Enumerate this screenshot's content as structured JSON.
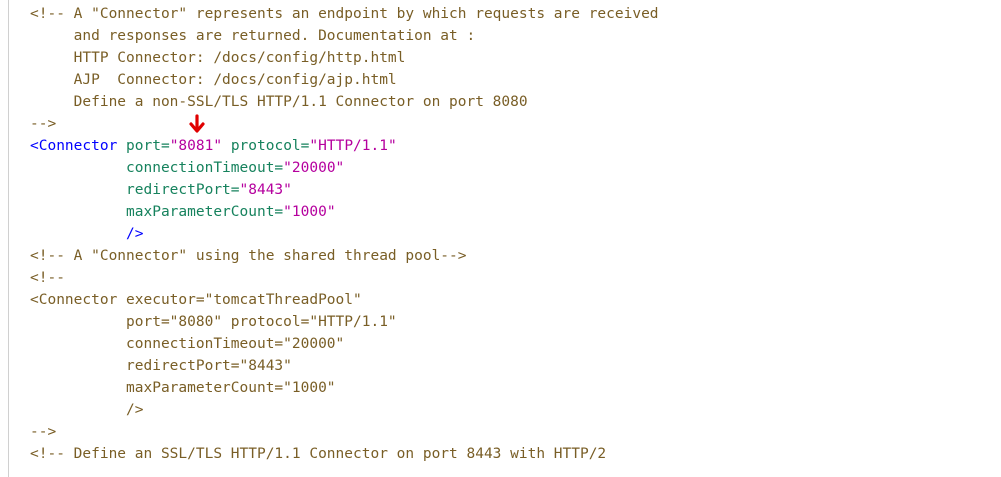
{
  "lines": [
    {
      "indent": 30,
      "segments": [
        {
          "t": "<!-- A \"Connector\" represents an endpoint by which requests are received",
          "c": "c-olive"
        }
      ]
    },
    {
      "indent": 30,
      "segments": [
        {
          "t": "     and responses are returned. Documentation at :",
          "c": "c-olive"
        }
      ]
    },
    {
      "indent": 30,
      "segments": [
        {
          "t": "     HTTP Connector: /docs/config/http.html",
          "c": "c-olive"
        }
      ]
    },
    {
      "indent": 30,
      "segments": [
        {
          "t": "     AJP  Connector: /docs/config/ajp.html",
          "c": "c-olive"
        }
      ]
    },
    {
      "indent": 30,
      "segments": [
        {
          "t": "     Define a non-SSL/TLS HTTP/1.1 Connector on port 8080",
          "c": "c-olive"
        }
      ]
    },
    {
      "indent": 30,
      "segments": [
        {
          "t": "-->",
          "c": "c-olive"
        }
      ]
    },
    {
      "indent": 30,
      "segments": [
        {
          "t": "<Connector",
          "c": "c-blue"
        },
        {
          "t": " port=",
          "c": "c-teal"
        },
        {
          "t": "\"8081\"",
          "c": "c-purple"
        },
        {
          "t": " protocol=",
          "c": "c-teal"
        },
        {
          "t": "\"HTTP/1.1\"",
          "c": "c-purple"
        }
      ]
    },
    {
      "indent": 30,
      "segments": [
        {
          "t": "           connectionTimeout=",
          "c": "c-teal"
        },
        {
          "t": "\"20000\"",
          "c": "c-purple"
        }
      ]
    },
    {
      "indent": 30,
      "segments": [
        {
          "t": "           redirectPort=",
          "c": "c-teal"
        },
        {
          "t": "\"8443\"",
          "c": "c-purple"
        }
      ]
    },
    {
      "indent": 30,
      "segments": [
        {
          "t": "           maxParameterCount=",
          "c": "c-teal"
        },
        {
          "t": "\"1000\"",
          "c": "c-purple"
        }
      ]
    },
    {
      "indent": 30,
      "segments": [
        {
          "t": "           />",
          "c": "c-blue"
        }
      ]
    },
    {
      "indent": 30,
      "segments": [
        {
          "t": "<!-- A \"Connector\" using the shared thread pool-->",
          "c": "c-olive"
        }
      ]
    },
    {
      "indent": 30,
      "segments": [
        {
          "t": "<!--",
          "c": "c-olive"
        }
      ]
    },
    {
      "indent": 30,
      "segments": [
        {
          "t": "<Connector executor=\"tomcatThreadPool\"",
          "c": "c-olive"
        }
      ]
    },
    {
      "indent": 30,
      "segments": [
        {
          "t": "           port=\"8080\" protocol=\"HTTP/1.1\"",
          "c": "c-olive"
        }
      ]
    },
    {
      "indent": 30,
      "segments": [
        {
          "t": "           connectionTimeout=\"20000\"",
          "c": "c-olive"
        }
      ]
    },
    {
      "indent": 30,
      "segments": [
        {
          "t": "           redirectPort=\"8443\"",
          "c": "c-olive"
        }
      ]
    },
    {
      "indent": 30,
      "segments": [
        {
          "t": "           maxParameterCount=\"1000\"",
          "c": "c-olive"
        }
      ]
    },
    {
      "indent": 30,
      "segments": [
        {
          "t": "           />",
          "c": "c-olive"
        }
      ]
    },
    {
      "indent": 30,
      "segments": [
        {
          "t": "-->",
          "c": "c-olive"
        }
      ]
    },
    {
      "indent": 30,
      "segments": [
        {
          "t": "<!-- Define an SSL/TLS HTTP/1.1 Connector on port 8443 with HTTP/2",
          "c": "c-olive"
        }
      ]
    }
  ],
  "marker": {
    "icon": "red-arrow-down-icon",
    "color": "#e00000"
  }
}
